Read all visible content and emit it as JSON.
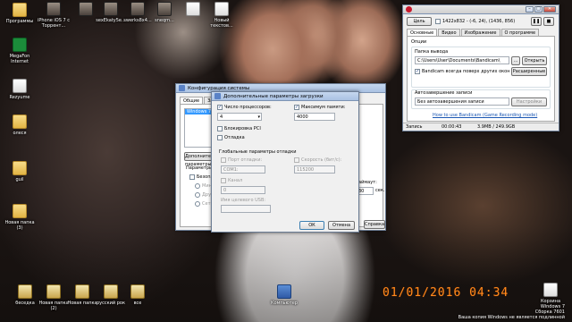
{
  "desktop": {
    "left_icons": [
      {
        "label": "Программы",
        "type": "folder"
      },
      {
        "label": "MegaFon Internet",
        "type": "mega"
      },
      {
        "label": "Rezyume",
        "type": "doc"
      },
      {
        "label": "олеся",
        "type": "folder"
      },
      {
        "label": "guil",
        "type": "folder"
      },
      {
        "label": "Новая папка (3)",
        "type": "folder"
      }
    ],
    "top_icons": [
      {
        "label": "iPhone iOS 7 с Торрент...",
        "type": "thumb"
      },
      {
        "label": "",
        "type": "thumb"
      },
      {
        "label": "sexEkaty5e...",
        "type": "thumb"
      },
      {
        "label": "swerks8x4...",
        "type": "thumb"
      },
      {
        "label": "sneqm...",
        "type": "thumb"
      },
      {
        "label": "",
        "type": "doc"
      },
      {
        "label": "Новый текстов...",
        "type": "doc"
      }
    ],
    "bottom_icons": [
      {
        "label": "беседка",
        "type": "zip"
      },
      {
        "label": "Новая папка (2)",
        "type": "zip"
      },
      {
        "label": "Новая папка",
        "type": "zip"
      },
      {
        "label": "русский рок",
        "type": "zip"
      },
      {
        "label": "все",
        "type": "zip"
      },
      {
        "label": "Компьютер",
        "type": "short"
      }
    ],
    "datestamp": "01/01/2016 04:34",
    "watermark": {
      "line1": "Windows 7",
      "line2": "Сборка 7601",
      "line3": "Ваша копия Windows не является подлинной"
    },
    "right_icon_label": "Корзина"
  },
  "config_window": {
    "title": "Конфигурация системы",
    "tab_general": "Общие",
    "tab_boot": "Загрузка",
    "list_item": "Windows 7",
    "advanced_button": "Дополнительные параметры...",
    "boot_options_label": "Параметры загрузки",
    "safe_mode": "Безопасный режим",
    "minimal": "Мин",
    "other_shell": "Другая оболочка",
    "network": "Сеть",
    "timeout_label": "Таймаут:",
    "timeout_value": "30",
    "timeout_unit": "сек.",
    "permanent": "Сделать эти параметры загрузки постоянными",
    "help_button": "Справка"
  },
  "advanced_dialog": {
    "title": "Дополнительные параметры загрузки",
    "num_processors_label": "Число процессоров:",
    "num_processors_value": "4",
    "max_memory_label": "Максимум памяти:",
    "max_memory_value": "4000",
    "pci_lock": "Блокировка PCI",
    "debug": "Отладка",
    "global_debug_label": "Глобальные параметры отладки",
    "debug_port_label": "Порт отладки:",
    "debug_port_value": "COM1:",
    "baud_rate_label": "Скорость (бит/с):",
    "baud_rate_value": "115200",
    "channel_label": "Канал",
    "channel_value": "0",
    "usb_target_label": "Имя целевого USB:",
    "ok_button": "ОК",
    "cancel_button": "Отмена"
  },
  "bandicam": {
    "title_button": "Цель",
    "resolution": "1422x832 - (-6, 24), (1436, 856)",
    "tabs": [
      "Основные",
      "Видео",
      "Изображение",
      "О программе"
    ],
    "options_label": "Опции",
    "output_folder_label": "Папка вывода",
    "output_folder_value": "C:\\Users\\User\\Documents\\Bandicam\\",
    "browse_button": "...",
    "open_button": "Открыть",
    "on_top_label": "Bandicam всегда поверх других окон",
    "advanced_button": "Расширенные",
    "autostart_label": "Автозавершение записи",
    "autostart_value": "Без автозавершения записи",
    "settings_button": "Настройки",
    "howto_link": "How to use Bandicam (Game Recording mode)",
    "status_label": "Запись",
    "status_time": "00:00:43",
    "status_size": "3.9MB / 249.9GB"
  }
}
